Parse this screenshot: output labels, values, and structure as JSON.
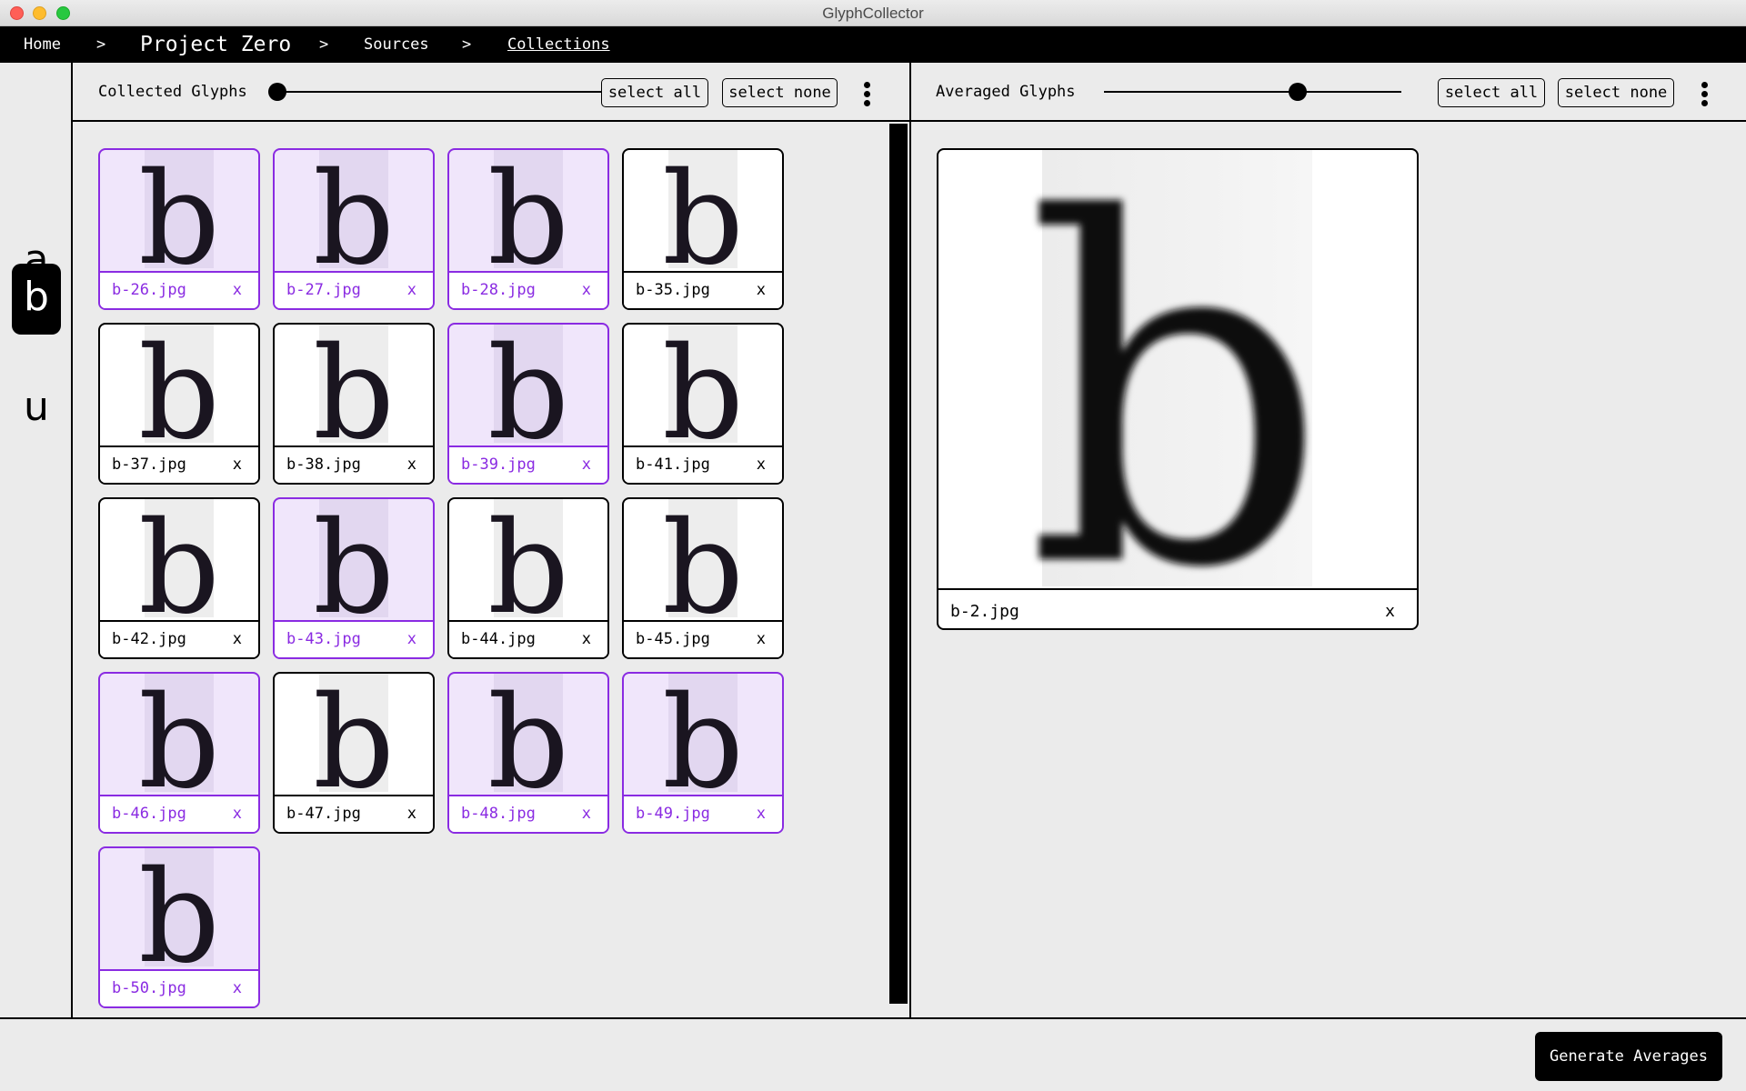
{
  "window": {
    "title": "GlyphCollector"
  },
  "breadcrumb": {
    "home": "Home",
    "project": "Project Zero",
    "sources": "Sources",
    "collections": "Collections",
    "separator": ">"
  },
  "letters": [
    "a",
    "b",
    "u"
  ],
  "active_letter": "b",
  "collected": {
    "title": "Collected Glyphs",
    "slider_fraction": 0.0,
    "select_all": "select all",
    "select_none": "select none",
    "remove_label": "x",
    "items": [
      {
        "name": "b-26.jpg",
        "selected": true
      },
      {
        "name": "b-27.jpg",
        "selected": true
      },
      {
        "name": "b-28.jpg",
        "selected": true
      },
      {
        "name": "b-35.jpg",
        "selected": false
      },
      {
        "name": "b-37.jpg",
        "selected": false
      },
      {
        "name": "b-38.jpg",
        "selected": false
      },
      {
        "name": "b-39.jpg",
        "selected": true
      },
      {
        "name": "b-41.jpg",
        "selected": false
      },
      {
        "name": "b-42.jpg",
        "selected": false
      },
      {
        "name": "b-43.jpg",
        "selected": true
      },
      {
        "name": "b-44.jpg",
        "selected": false
      },
      {
        "name": "b-45.jpg",
        "selected": false
      },
      {
        "name": "b-46.jpg",
        "selected": true
      },
      {
        "name": "b-47.jpg",
        "selected": false
      },
      {
        "name": "b-48.jpg",
        "selected": true
      },
      {
        "name": "b-49.jpg",
        "selected": true
      },
      {
        "name": "b-50.jpg",
        "selected": true
      }
    ]
  },
  "averaged": {
    "title": "Averaged Glyphs",
    "slider_fraction": 0.65,
    "select_all": "select all",
    "select_none": "select none",
    "remove_label": "x",
    "items": [
      {
        "name": "b-2.jpg"
      }
    ]
  },
  "footer": {
    "generate_label": "Generate Averages"
  },
  "colors": {
    "selected_accent": "#8a2be2",
    "selected_fill": "#f0e6fb"
  },
  "glyph_char": "b"
}
